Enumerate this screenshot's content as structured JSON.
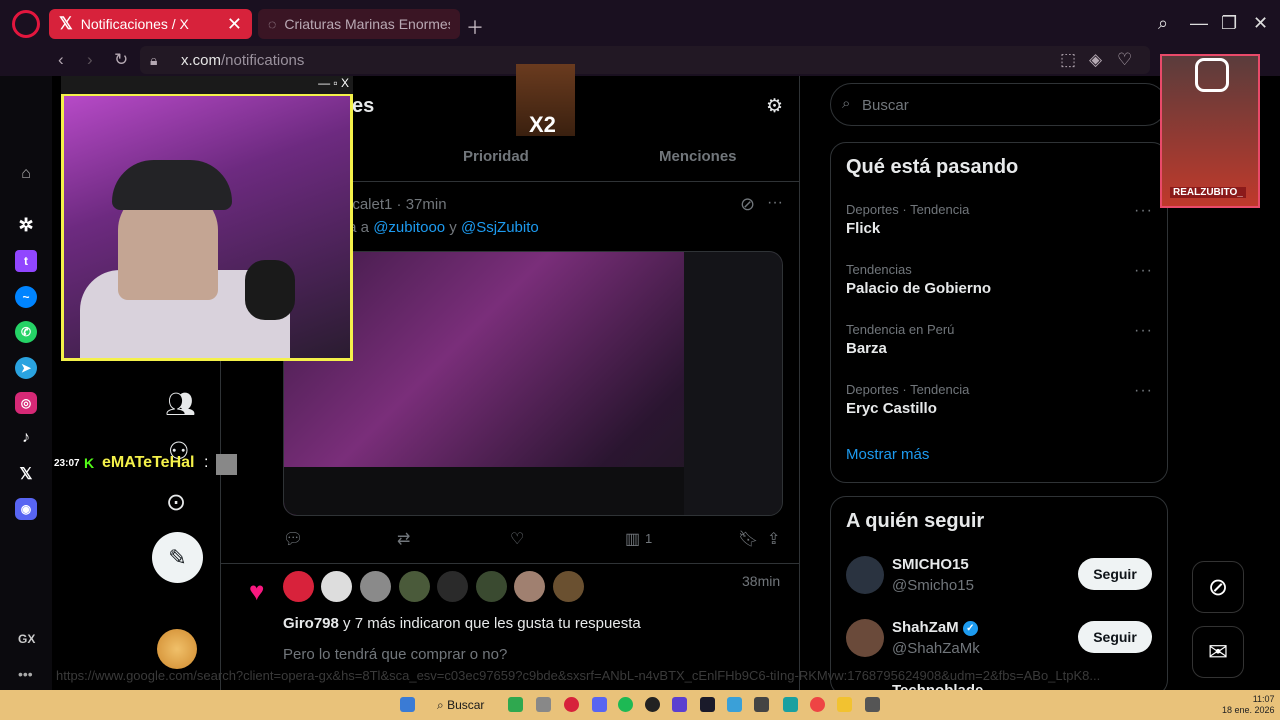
{
  "browser": {
    "tabs": [
      {
        "title": "Notificaciones / X",
        "active": true
      },
      {
        "title": "Criaturas Marinas Enormes",
        "active": false
      }
    ],
    "url": {
      "host": "x.com",
      "path": "/notifications"
    },
    "status_url": "https://www.google.com/search?client=opera-gx&hs=8Tl&sca_esv=c03ec97659?c9bde&sxsrf=ANbL-n4vBTX_cEnlFHb9C6-tiIng-RKMvw:1768795624908&udm=2&fbs=ABo_LtpK8..."
  },
  "main": {
    "title_fragment": "es",
    "tabs": [
      "Prioridad",
      "Menciones"
    ],
    "tweet": {
      "header": "ecalet1 · 37min",
      "reply_prefix": "ta a ",
      "reply_mention_1": "@zubitooo",
      "reply_and": " y ",
      "reply_mention_2": "@SsjZubito",
      "views": "1"
    },
    "likes": {
      "time": "38min",
      "who": "Giro798",
      "text": " y 7 más indicaron que les gusta tu respuesta",
      "quote": "Pero lo tendrá que comprar o no?"
    }
  },
  "right": {
    "search_placeholder": "Buscar",
    "trending_title": "Qué está pasando",
    "trends": [
      {
        "category": "Deportes · Tendencia",
        "name": "Flick"
      },
      {
        "category": "Tendencias",
        "name": "Palacio de Gobierno"
      },
      {
        "category": "Tendencia en Perú",
        "name": "Barza"
      },
      {
        "category": "Deportes · Tendencia",
        "name": "Eryc Castillo"
      }
    ],
    "show_more": "Mostrar más",
    "follow_title": "A quién seguir",
    "follow": [
      {
        "name": "SMICHO15",
        "handle": "@Smicho15",
        "button": "Seguir"
      },
      {
        "name": "ShahZaM",
        "handle": "@ShahZaMk",
        "button": "Seguir"
      },
      {
        "name": "Technoblade"
      }
    ]
  },
  "overlay": {
    "emote_label": "X2",
    "chat_time": "23:07",
    "chat_user": "eMATeTeHal",
    "ig_name": "REALZUBITO_"
  },
  "sidebar": {
    "gx_label": "GX"
  },
  "taskbar": {
    "search_label": "Buscar",
    "time": "11:07",
    "date": "18 ene. 2026"
  },
  "colors": {
    "accent": "#1d9bf0",
    "tab_active": "#d7223b",
    "like": "#f91880",
    "overlay_border": "#f4f14a"
  }
}
